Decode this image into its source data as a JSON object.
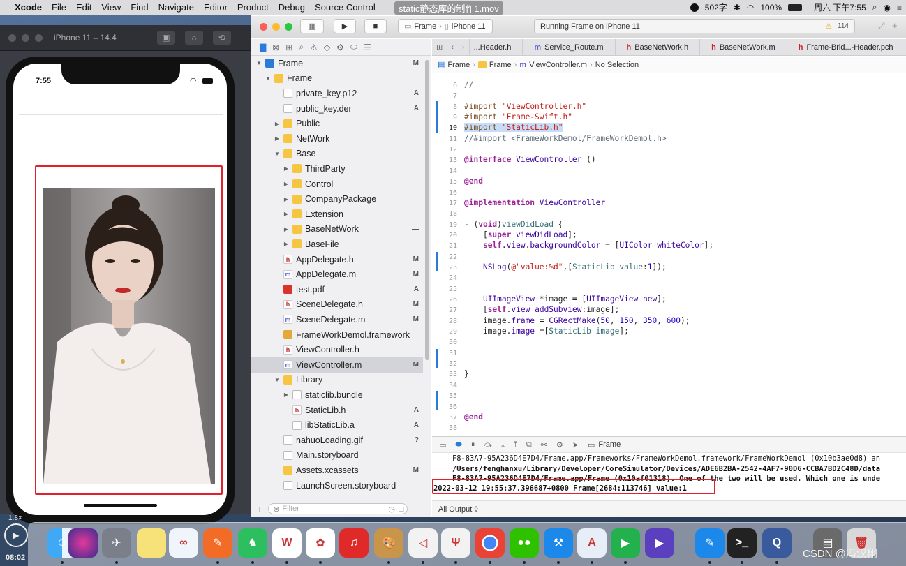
{
  "menubar": {
    "apple": "",
    "app_name": "Xcode",
    "items": [
      "File",
      "Edit",
      "View",
      "Find",
      "Navigate",
      "Editor",
      "Product",
      "Debug",
      "Source Control"
    ],
    "title_overlay": "static静态库的制作1.mov",
    "status_word_count": "502字",
    "battery": "100%",
    "datetime": "周六 下午7:55"
  },
  "simulator": {
    "title": "iPhone 11 – 14.4",
    "status_time": "7:55",
    "zoom": "1.8×",
    "recording_time": "08:02"
  },
  "toolbar": {
    "scheme": "Frame",
    "device": "iPhone 11",
    "status": "Running Frame on iPhone 11",
    "warning_count": "114"
  },
  "tabs": [
    "...Header.h",
    "Service_Route.m",
    "BaseNetWork.h",
    "BaseNetWork.m",
    "Frame-Brid...-Header.pch"
  ],
  "jumpbar": [
    "Frame",
    "Frame",
    "ViewController.m",
    "No Selection"
  ],
  "navigator": {
    "filter_placeholder": "Filter",
    "tree": [
      {
        "label": "Frame",
        "type": "project",
        "depth": 0,
        "expanded": true,
        "badge": "M"
      },
      {
        "label": "Frame",
        "type": "folder",
        "depth": 1,
        "expanded": true,
        "badge": ""
      },
      {
        "label": "private_key.p12",
        "type": "file",
        "depth": 2,
        "badge": "A"
      },
      {
        "label": "public_key.der",
        "type": "file",
        "depth": 2,
        "badge": "A"
      },
      {
        "label": "Public",
        "type": "folder",
        "depth": 2,
        "expanded": false,
        "badge": "—"
      },
      {
        "label": "NetWork",
        "type": "folder",
        "depth": 2,
        "expanded": false,
        "badge": ""
      },
      {
        "label": "Base",
        "type": "folder",
        "depth": 2,
        "expanded": true,
        "badge": ""
      },
      {
        "label": "ThirdParty",
        "type": "folder",
        "depth": 3,
        "expanded": false,
        "badge": ""
      },
      {
        "label": "Control",
        "type": "folder",
        "depth": 3,
        "expanded": false,
        "badge": "—"
      },
      {
        "label": "CompanyPackage",
        "type": "folder",
        "depth": 3,
        "expanded": false,
        "badge": ""
      },
      {
        "label": "Extension",
        "type": "folder",
        "depth": 3,
        "expanded": false,
        "badge": "—"
      },
      {
        "label": "BaseNetWork",
        "type": "folder",
        "depth": 3,
        "expanded": false,
        "badge": "—"
      },
      {
        "label": "BaseFile",
        "type": "folder",
        "depth": 3,
        "expanded": false,
        "badge": "—"
      },
      {
        "label": "AppDelegate.h",
        "type": "h",
        "depth": 2,
        "badge": "M"
      },
      {
        "label": "AppDelegate.m",
        "type": "m",
        "depth": 2,
        "badge": "M"
      },
      {
        "label": "test.pdf",
        "type": "pdf",
        "depth": 2,
        "badge": "A"
      },
      {
        "label": "SceneDelegate.h",
        "type": "h",
        "depth": 2,
        "badge": "M"
      },
      {
        "label": "SceneDelegate.m",
        "type": "m",
        "depth": 2,
        "badge": "M"
      },
      {
        "label": "FrameWorkDemol.framework",
        "type": "framework",
        "depth": 2,
        "badge": ""
      },
      {
        "label": "ViewController.h",
        "type": "h",
        "depth": 2,
        "badge": ""
      },
      {
        "label": "ViewController.m",
        "type": "m",
        "depth": 2,
        "badge": "M",
        "selected": true
      },
      {
        "label": "Library",
        "type": "folder",
        "depth": 2,
        "expanded": true,
        "badge": ""
      },
      {
        "label": "staticlib.bundle",
        "type": "bundle",
        "depth": 3,
        "expanded": false,
        "badge": ""
      },
      {
        "label": "StaticLib.h",
        "type": "h",
        "depth": 3,
        "badge": "A"
      },
      {
        "label": "libStaticLib.a",
        "type": "file",
        "depth": 3,
        "badge": "A"
      },
      {
        "label": "nahuoLoading.gif",
        "type": "file",
        "depth": 2,
        "badge": "?"
      },
      {
        "label": "Main.storyboard",
        "type": "file",
        "depth": 2,
        "badge": ""
      },
      {
        "label": "Assets.xcassets",
        "type": "folder",
        "depth": 2,
        "badge": "M"
      },
      {
        "label": "LaunchScreen.storyboard",
        "type": "file",
        "depth": 2,
        "badge": ""
      }
    ]
  },
  "editor": {
    "lines": [
      {
        "n": "6",
        "html": "<span class=\"cm\">//</span>"
      },
      {
        "n": "7",
        "html": ""
      },
      {
        "n": "8",
        "html": "<span class=\"pp\">#import</span> <span class=\"str\">\"ViewController.h\"</span>"
      },
      {
        "n": "9",
        "html": "<span class=\"pp\">#import</span> <span class=\"str\">\"Frame-Swift.h\"</span>"
      },
      {
        "n": "10",
        "html": "<span class=\"hl\"><span class=\"pp\">#import</span> <span class=\"str\">\"StaticLib.h\"</span></span>"
      },
      {
        "n": "11",
        "html": "<span class=\"cm\">//#import &lt;FrameWorkDemol/FrameWorkDemol.h&gt;</span>"
      },
      {
        "n": "12",
        "html": ""
      },
      {
        "n": "13",
        "html": "<span class=\"kw\">@interface</span> <span class=\"tp\">ViewController</span> ()"
      },
      {
        "n": "14",
        "html": ""
      },
      {
        "n": "15",
        "html": "<span class=\"kw\">@end</span>"
      },
      {
        "n": "16",
        "html": ""
      },
      {
        "n": "17",
        "html": "<span class=\"kw\">@implementation</span> <span class=\"tp\">ViewController</span>"
      },
      {
        "n": "18",
        "html": ""
      },
      {
        "n": "19",
        "html": "- (<span class=\"kw\">void</span>)<span class=\"fn\">viewDidLoad</span> {"
      },
      {
        "n": "20",
        "html": "    [<span class=\"kw\">super</span> <span class=\"tp\">viewDidLoad</span>];"
      },
      {
        "n": "21",
        "html": "    <span class=\"kw\">self</span>.<span class=\"tp\">view</span>.<span class=\"tp\">backgroundColor</span> = [<span class=\"tp\">UIColor</span> <span class=\"tp\">whiteColor</span>];"
      },
      {
        "n": "22",
        "html": ""
      },
      {
        "n": "23",
        "html": "    <span class=\"tp\">NSLog</span>(<span class=\"str\">@\"value:%d\"</span>,[<span class=\"fn\">StaticLib</span> <span class=\"fn\">value</span>:<span class=\"num\">1</span>]);"
      },
      {
        "n": "24",
        "html": ""
      },
      {
        "n": "25",
        "html": ""
      },
      {
        "n": "26",
        "html": "    <span class=\"tp\">UIImageView</span> *image = [<span class=\"tp\">UIImageView</span> <span class=\"tp\">new</span>];"
      },
      {
        "n": "27",
        "html": "    [<span class=\"kw\">self</span>.<span class=\"tp\">view</span> <span class=\"tp\">addSubview</span>:image];"
      },
      {
        "n": "28",
        "html": "    image.<span class=\"tp\">frame</span> = <span class=\"tp\">CGRectMake</span>(<span class=\"num\">50</span>, <span class=\"num\">150</span>, <span class=\"num\">350</span>, <span class=\"num\">600</span>);"
      },
      {
        "n": "29",
        "html": "    image.<span class=\"tp\">image</span> =[<span class=\"fn\">StaticLib</span> <span class=\"fn\">image</span>];"
      },
      {
        "n": "30",
        "html": ""
      },
      {
        "n": "31",
        "html": ""
      },
      {
        "n": "32",
        "html": ""
      },
      {
        "n": "33",
        "html": "}"
      },
      {
        "n": "34",
        "html": ""
      },
      {
        "n": "35",
        "html": ""
      },
      {
        "n": "36",
        "html": ""
      },
      {
        "n": "37",
        "html": "<span class=\"kw\">@end</span>"
      },
      {
        "n": "38",
        "html": ""
      }
    ]
  },
  "debugbar": {
    "target": "Frame"
  },
  "console": {
    "lines": [
      "F8-83A7-95A236D4E7D4/Frame.app/Frameworks/FrameWorkDemol.framework/FrameWorkDemol (0x10b3ae0d8) an",
      "/Users/fenghanxu/Library/Developer/CoreSimulator/Devices/ADE6B2BA-2542-4AF7-90D6-CCBA7BD2C48D/data",
      "F8-83A7-95A236D4E7D4/Frame.app/Frame (0x10af01318). One of the two will be used. Which one is unde"
    ],
    "highlight": "2022-03-12 19:55:37.396687+0800 Frame[2684:113746] value:1",
    "output_filter": "All Output ◊"
  },
  "watermark": "CSDN @冯汉栩",
  "colors": {
    "highlight_red": "#e0212a"
  }
}
